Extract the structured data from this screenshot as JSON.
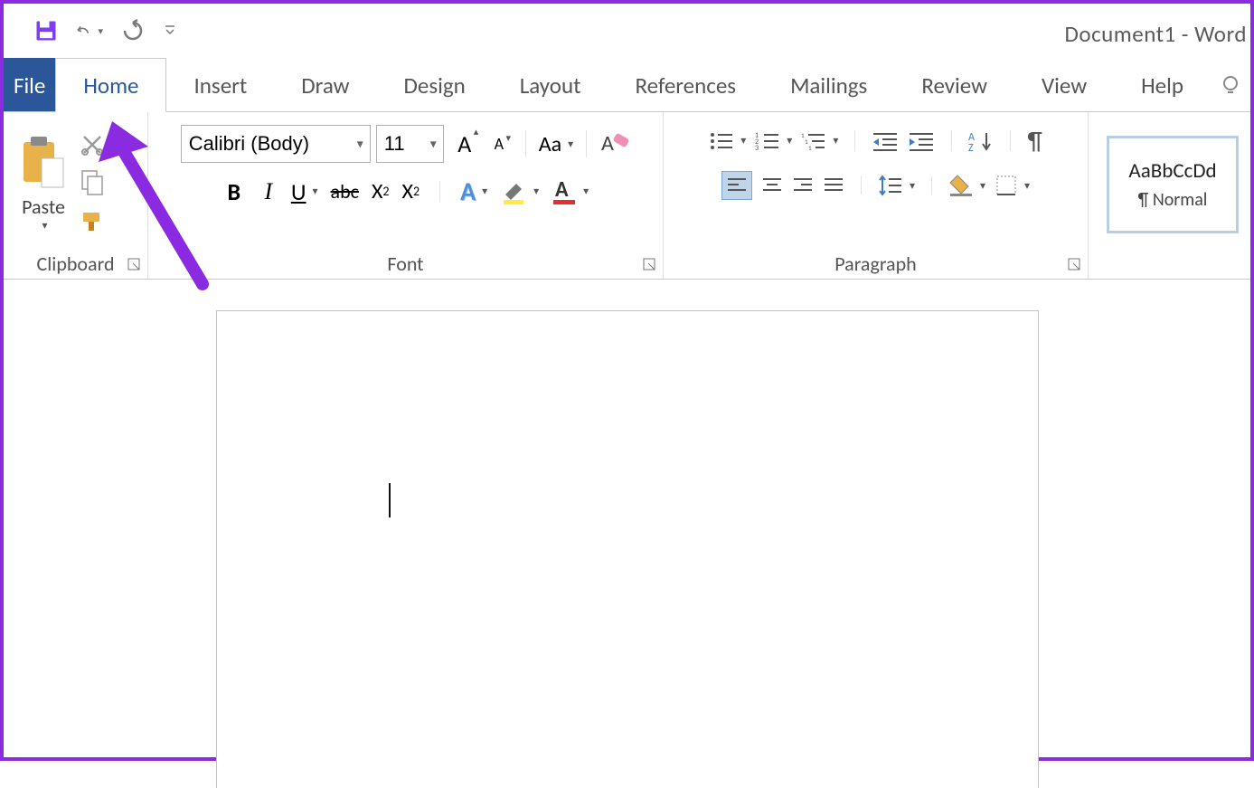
{
  "title": "Document1  -  Word",
  "tabs": {
    "file": "File",
    "home": "Home",
    "insert": "Insert",
    "draw": "Draw",
    "design": "Design",
    "layout": "Layout",
    "references": "References",
    "mailings": "Mailings",
    "review": "Review",
    "view": "View",
    "help": "Help"
  },
  "groups": {
    "clipboard": "Clipboard",
    "font": "Font",
    "paragraph": "Paragraph",
    "styles": ""
  },
  "clipboard": {
    "paste": "Paste"
  },
  "font": {
    "name": "Calibri (Body)",
    "size": "11"
  },
  "style": {
    "preview": "AaBbCcDd",
    "name": "¶ Normal"
  }
}
